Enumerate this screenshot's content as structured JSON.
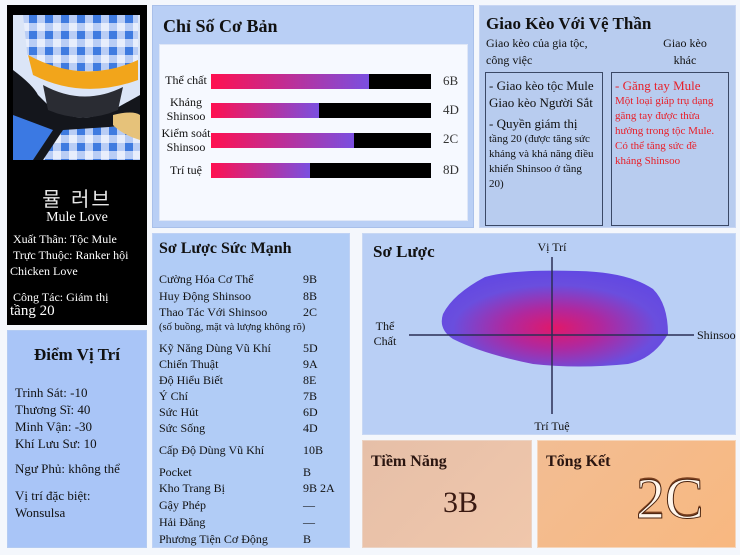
{
  "profile": {
    "korean_name": "뮬 러브",
    "name": "Mule Love",
    "origin": "Xuất Thân: Tộc Mule",
    "affiliation_line1": "Trực Thuộc: Ranker hội",
    "affiliation_line2": "Chicken Love",
    "job_line1": "Công Tác: Giám thị",
    "job_line2": "tầng 20"
  },
  "basic_stats": {
    "title": "Chỉ Số Cơ Bản",
    "items": [
      {
        "label_1": "Thể chất",
        "label_2": "",
        "value": "6B",
        "fill": 0.72
      },
      {
        "label_1": "Kháng",
        "label_2": "Shinsoo",
        "value": "4D",
        "fill": 0.49
      },
      {
        "label_1": "Kiểm soát",
        "label_2": "Shinsoo",
        "value": "2C",
        "fill": 0.65
      },
      {
        "label_1": "Trí tuệ",
        "label_2": "",
        "value": "8D",
        "fill": 0.45
      }
    ],
    "colors": {
      "start": "#ff1050",
      "end": "#7a4fe0",
      "track": "#000000"
    }
  },
  "contract": {
    "title": "Giao Kèo Với Vệ Thần",
    "col1_header_1": "Giao kèo của gia tộc,",
    "col1_header_2": "công việc",
    "col2_header_1": "Giao kèo",
    "col2_header_2": "khác",
    "col1_item1_1": "- Giao kèo tộc Mule",
    "col1_item1_2": "Giao kèo Người Sắt",
    "col1_item2_1": "- Quyền giám thị",
    "col1_item2_2": "tầng 20 (được tăng sức kháng và khả năng điều khiển Shinsoo ở tầng 20)",
    "col2_item_title": "- Găng tay Mule",
    "col2_item_desc": "Một loại giáp trụ dạng găng tay được thừa hưởng trong tộc Mule. Có thể tăng sức đề kháng Shinsoo",
    "accent_color": "#e8202a"
  },
  "position_points": {
    "title": "Điểm Vị Trí",
    "items": [
      "Trinh Sát: -10",
      "Thương Sĩ: 40",
      "Minh Vận: -30",
      "Khí Lưu Sư: 10",
      "Ngư Phủ: không thể",
      "Vị trí đặc biệt:",
      "Wonsulsa"
    ]
  },
  "power": {
    "title": "Sơ Lược Sức Mạnh",
    "rows": [
      {
        "name": "Cường Hóa Cơ Thể",
        "value": "9B"
      },
      {
        "name": "Huy Động Shinsoo",
        "value": "8B"
      },
      {
        "name": "Thao Tác Với Shinsoo",
        "value": "2C"
      },
      {
        "name": "(số buồng, mặt và lượng không rõ)",
        "value": ""
      },
      {
        "name": "Kỹ Năng Dùng Vũ Khí",
        "value": "5D"
      },
      {
        "name": "Chiến Thuật",
        "value": "9A"
      },
      {
        "name": "Độ Hiểu Biết",
        "value": "8E"
      },
      {
        "name": "Ý Chí",
        "value": "7B"
      },
      {
        "name": "Sức Hút",
        "value": "6D"
      },
      {
        "name": "Sức Sống",
        "value": "4D"
      },
      {
        "name": "Cấp Độ Dùng Vũ Khí",
        "value": "10B"
      },
      {
        "name": "Pocket",
        "value": "B"
      },
      {
        "name": "Kho Trang Bị",
        "value": "9B 2A"
      },
      {
        "name": "Gậy Phép",
        "value": "—"
      },
      {
        "name": "Hải Đăng",
        "value": "—"
      },
      {
        "name": "Phương Tiện Cơ Động",
        "value": "B"
      }
    ]
  },
  "overview": {
    "title": "Sơ Lược",
    "axis_top": "Vị Trí",
    "axis_bottom": "Trí Tuệ",
    "axis_left_1": "Thể",
    "axis_left_2": "Chất",
    "axis_right": "Shinsoo"
  },
  "potential": {
    "title": "Tiềm Năng",
    "value": "3B"
  },
  "summary": {
    "title": "Tổng Kết",
    "value": "2C"
  }
}
